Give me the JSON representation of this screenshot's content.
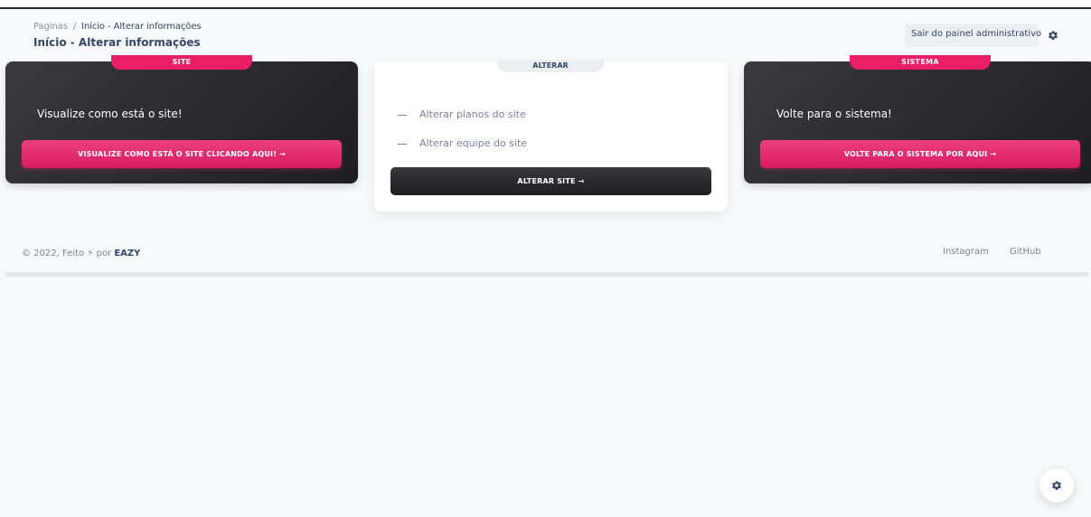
{
  "breadcrumb": {
    "root": "Paginas",
    "separator": "/",
    "current": "Início - Alterar informações"
  },
  "page_title": "Início - Alterar informações",
  "header": {
    "admin_link": "Sair do painel administrativo",
    "settings_icon": "gear-icon"
  },
  "cards": {
    "site": {
      "tab": "SITE",
      "text": "Visualize como está o site!",
      "button": "VISUALIZE COMO ESTÁ O SITE CLICANDO AQUI! →"
    },
    "alterar": {
      "tab": "ALTERAR",
      "items": [
        "Alterar planos do site",
        "Alterar equipe do site"
      ],
      "button": "ALTERAR SITE →"
    },
    "sistema": {
      "tab": "SISTEMA",
      "text": "Volte para o sistema!",
      "button": "VOLTE PARA O SISTEMA POR AQUI →"
    }
  },
  "footer": {
    "copy_prefix": "© 2022, Feito",
    "bolt": "⚡",
    "copy_by": "por",
    "brand": "EAZY",
    "links": [
      "Instagram",
      "GitHub"
    ]
  },
  "colors": {
    "accent": "#e91e63",
    "dark": "#2a2a2e",
    "text": "#344767",
    "muted": "#7b809a"
  }
}
